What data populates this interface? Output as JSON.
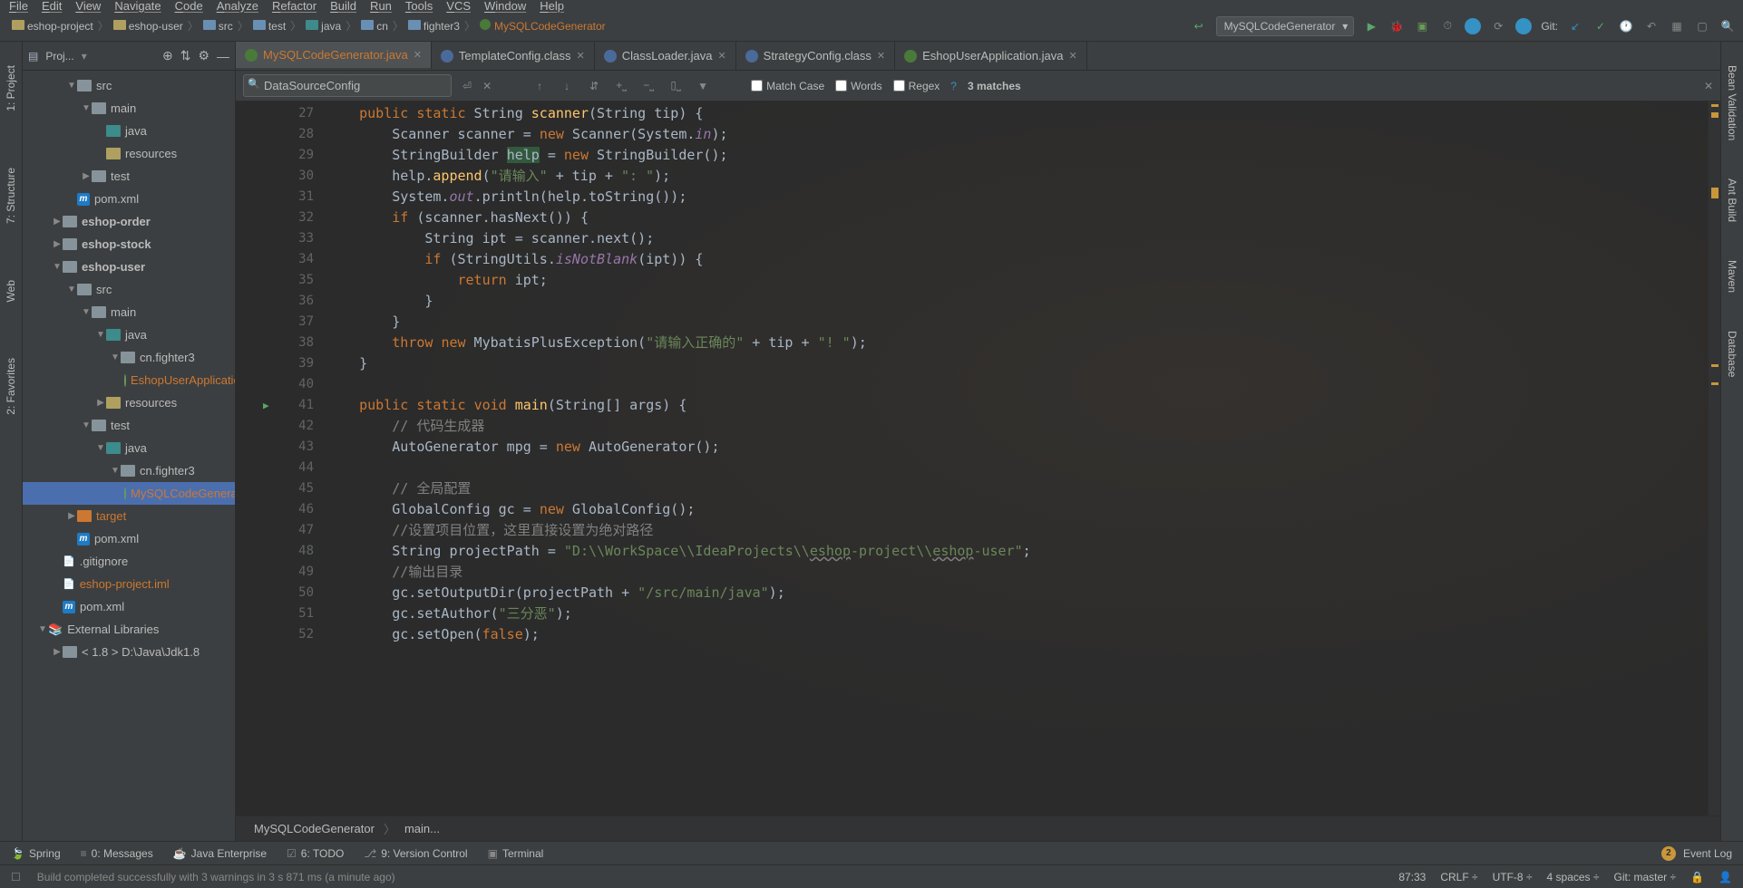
{
  "menu": [
    "File",
    "Edit",
    "View",
    "Navigate",
    "Code",
    "Analyze",
    "Refactor",
    "Build",
    "Run",
    "Tools",
    "VCS",
    "Window",
    "Help"
  ],
  "breadcrumbs": [
    {
      "label": "eshop-project",
      "type": "folder"
    },
    {
      "label": "eshop-user",
      "type": "folder"
    },
    {
      "label": "src",
      "type": "blue"
    },
    {
      "label": "test",
      "type": "blue"
    },
    {
      "label": "java",
      "type": "teal"
    },
    {
      "label": "cn",
      "type": "blue"
    },
    {
      "label": "fighter3",
      "type": "blue"
    },
    {
      "label": "MySQLCodeGenerator",
      "type": "class",
      "hl": true
    }
  ],
  "run_config": "MySQLCodeGenerator",
  "git_label": "Git:",
  "sidebar": {
    "title": "Proj...",
    "tree": [
      {
        "indent": 3,
        "arrow": "▼",
        "icon": "dir",
        "label": "src"
      },
      {
        "indent": 4,
        "arrow": "▼",
        "icon": "dir",
        "label": "main"
      },
      {
        "indent": 5,
        "arrow": "",
        "icon": "src",
        "label": "java"
      },
      {
        "indent": 5,
        "arrow": "",
        "icon": "res",
        "label": "resources"
      },
      {
        "indent": 4,
        "arrow": "▶",
        "icon": "dir",
        "label": "test"
      },
      {
        "indent": 3,
        "arrow": "",
        "icon": "m",
        "label": "pom.xml",
        "mtext": "m"
      },
      {
        "indent": 2,
        "arrow": "▶",
        "icon": "dir",
        "label": "eshop-order",
        "bold": true
      },
      {
        "indent": 2,
        "arrow": "▶",
        "icon": "dir",
        "label": "eshop-stock",
        "bold": true
      },
      {
        "indent": 2,
        "arrow": "▼",
        "icon": "dir",
        "label": "eshop-user",
        "bold": true
      },
      {
        "indent": 3,
        "arrow": "▼",
        "icon": "dir",
        "label": "src"
      },
      {
        "indent": 4,
        "arrow": "▼",
        "icon": "dir",
        "label": "main"
      },
      {
        "indent": 5,
        "arrow": "▼",
        "icon": "src",
        "label": "java"
      },
      {
        "indent": 6,
        "arrow": "▼",
        "icon": "pkg",
        "label": "cn.fighter3"
      },
      {
        "indent": 7,
        "arrow": "",
        "icon": "cls",
        "label": "EshopUserApplication",
        "hl": true
      },
      {
        "indent": 5,
        "arrow": "▶",
        "icon": "res",
        "label": "resources"
      },
      {
        "indent": 4,
        "arrow": "▼",
        "icon": "dir",
        "label": "test"
      },
      {
        "indent": 5,
        "arrow": "▼",
        "icon": "src",
        "label": "java"
      },
      {
        "indent": 6,
        "arrow": "▼",
        "icon": "pkg",
        "label": "cn.fighter3"
      },
      {
        "indent": 7,
        "arrow": "",
        "icon": "cls",
        "label": "MySQLCodeGenerator",
        "hl": true,
        "sel": true
      },
      {
        "indent": 3,
        "arrow": "▶",
        "icon": "tgt",
        "label": "target",
        "hl": true
      },
      {
        "indent": 3,
        "arrow": "",
        "icon": "m",
        "label": "pom.xml",
        "mtext": "m"
      },
      {
        "indent": 2,
        "arrow": "",
        "icon": "file",
        "label": ".gitignore"
      },
      {
        "indent": 2,
        "arrow": "",
        "icon": "file",
        "label": "eshop-project.iml",
        "hl": true
      },
      {
        "indent": 2,
        "arrow": "",
        "icon": "m",
        "label": "pom.xml",
        "mtext": "m"
      },
      {
        "indent": 1,
        "arrow": "▼",
        "icon": "lib",
        "label": "External Libraries"
      },
      {
        "indent": 2,
        "arrow": "▶",
        "icon": "dir",
        "label": "< 1.8 >  D:\\Java\\Jdk1.8"
      }
    ]
  },
  "left_tabs": [
    "1: Project",
    "7: Structure",
    "Web",
    "2: Favorites"
  ],
  "right_tabs": [
    "Bean Validation",
    "Ant Build",
    "Maven",
    "Database"
  ],
  "editor_tabs": [
    {
      "label": "MySQLCodeGenerator.java",
      "icon": "c",
      "active": true
    },
    {
      "label": "TemplateConfig.class",
      "icon": "cl"
    },
    {
      "label": "ClassLoader.java",
      "icon": "cl"
    },
    {
      "label": "StrategyConfig.class",
      "icon": "cl"
    },
    {
      "label": "EshopUserApplication.java",
      "icon": "c"
    }
  ],
  "find": {
    "query": "DataSourceConfig",
    "match_case": "Match Case",
    "words": "Words",
    "regex": "Regex",
    "matches": "3 matches"
  },
  "code_start_line": 27,
  "code_lines": [
    {
      "html": "    <span class='kw'>public</span> <span class='kw'>static</span> String <span class='fn'>scanner</span>(String tip) {"
    },
    {
      "html": "        Scanner scanner = <span class='kw'>new</span> Scanner(System.<span class='it'>in</span>);"
    },
    {
      "html": "        StringBuilder <span style='background:#32593d;'>help</span> = <span class='kw'>new</span> StringBuilder();"
    },
    {
      "html": "        help.<span class='fn'>append</span>(<span class='str'>\"请输入\"</span> + tip + <span class='str'>\": \"</span>);"
    },
    {
      "html": "        System.<span class='it'>out</span>.println(help.toString());"
    },
    {
      "html": "        <span class='kw'>if</span> (scanner.hasNext()) {"
    },
    {
      "html": "            String ipt = scanner.next();"
    },
    {
      "html": "            <span class='kw'>if</span> (StringUtils.<span class='it'>isNotBlank</span>(ipt)) {"
    },
    {
      "html": "                <span class='kw'>return</span> ipt;"
    },
    {
      "html": "            }"
    },
    {
      "html": "        }"
    },
    {
      "html": "        <span class='kw'>throw</span> <span class='kw'>new</span> MybatisPlusException(<span class='str'>\"请输入正确的\"</span> + tip + <span class='str'>\"! \"</span>);"
    },
    {
      "html": "    }"
    },
    {
      "html": ""
    },
    {
      "html": "    <span class='kw'>public</span> <span class='kw'>static</span> <span class='kw'>void</span> <span class='fn'>main</span>(String[] args) {",
      "run": true
    },
    {
      "html": "        <span class='com'>// 代码生成器</span>"
    },
    {
      "html": "        AutoGenerator mpg = <span class='kw'>new</span> AutoGenerator();"
    },
    {
      "html": ""
    },
    {
      "html": "        <span class='com'>// 全局配置</span>"
    },
    {
      "html": "        GlobalConfig gc = <span class='kw'>new</span> GlobalConfig();"
    },
    {
      "html": "        <span class='com'>//设置项目位置，这里直接设置为绝对路径</span>"
    },
    {
      "html": "        String projectPath = <span class='str'>\"D:\\\\WorkSpace\\\\IdeaProjects\\\\<span style='text-decoration:underline wavy #808080'>eshop</span>-project\\\\<span style='text-decoration:underline wavy #808080'>eshop</span>-user\"</span>;"
    },
    {
      "html": "        <span class='com'>//输出目录</span>"
    },
    {
      "html": "        gc.setOutputDir(projectPath + <span class='str'>\"/src/main/java\"</span>);"
    },
    {
      "html": "        gc.setAuthor(<span class='str'>\"三分恶\"</span>);"
    },
    {
      "html": "        gc.setOpen(<span class='kw'>false</span>);"
    }
  ],
  "crumb": {
    "a": "MySQLCodeGenerator",
    "b": "main..."
  },
  "bottom_tabs": [
    "Spring",
    "0: Messages",
    "Java Enterprise",
    "6: TODO",
    "9: Version Control",
    "Terminal"
  ],
  "event_log": "Event Log",
  "event_badge": "2",
  "status_msg": "Build completed successfully with 3 warnings in 3 s 871 ms (a minute ago)",
  "status_right": {
    "pos": "87:33",
    "eol": "CRLF",
    "enc": "UTF-8",
    "indent": "4 spaces",
    "git": "Git: master"
  }
}
